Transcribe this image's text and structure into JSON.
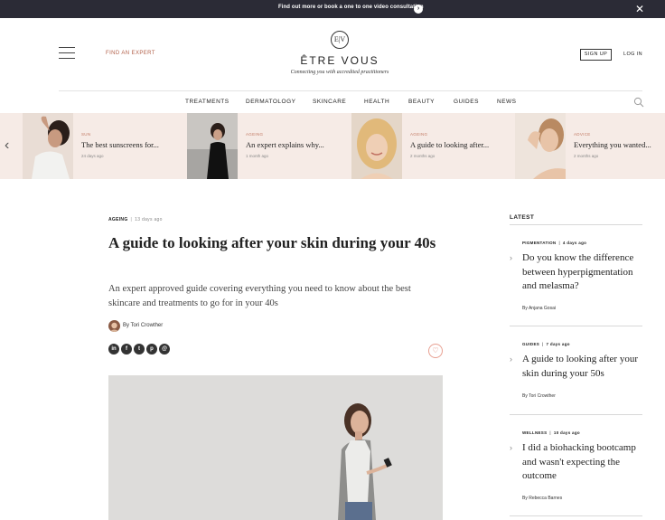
{
  "promo": {
    "text": "Find out more or book a one to one video consultation",
    "arrow_icon": "chevron-right-icon",
    "close_icon": "close-icon"
  },
  "header": {
    "find_expert": "FIND AN EXPERT",
    "logo_mark": "E|V",
    "logo_text": "ÊTRE VOUS",
    "tagline": "Connecting you with accredited practitioners",
    "signup": "SIGN UP",
    "login": "LOG IN"
  },
  "nav": {
    "items": [
      "TREATMENTS",
      "DERMATOLOGY",
      "SKINCARE",
      "HEALTH",
      "BEAUTY",
      "GUIDES",
      "NEWS"
    ],
    "search_icon": "search-icon"
  },
  "carousel": {
    "prev_icon": "chevron-left-icon",
    "cards": [
      {
        "category": "SUN",
        "title": "The best sunscreens for...",
        "meta": "24 days ago"
      },
      {
        "category": "AGEING",
        "title": "An expert explains why...",
        "meta": "1 month ago"
      },
      {
        "category": "AGEING",
        "title": "A guide to looking after...",
        "meta": "2 months ago"
      },
      {
        "category": "ADVICE",
        "title": "Everything you wanted...",
        "meta": "2 months ago"
      }
    ]
  },
  "article": {
    "category": "AGEING",
    "time": "13 days ago",
    "title": "A guide to looking after your skin during your 40s",
    "subtitle": "An expert approved guide covering everything you need to know about the best skincare and treatments to go for in your 40s",
    "author": "By Tori Crowther",
    "share_icons": [
      "linkedin-icon",
      "facebook-icon",
      "twitter-icon",
      "pinterest-icon",
      "email-icon"
    ],
    "share_glyphs": [
      "in",
      "f",
      "t",
      "p",
      "@"
    ],
    "heart_icon": "heart-icon"
  },
  "latest": {
    "heading": "LATEST",
    "items": [
      {
        "category": "PIGMENTATION",
        "time": "4 days ago",
        "title": "Do you know the difference between hyperpigmentation and melasma?",
        "author": "By Anjana Gosai"
      },
      {
        "category": "GUIDES",
        "time": "7 days ago",
        "title": "A guide to looking after your skin during your 50s",
        "author": "By Tori Crowther"
      },
      {
        "category": "WELLNESS",
        "time": "10 days ago",
        "title": "I did a biohacking bootcamp and wasn't expecting the outcome",
        "author": "By Rebecca Barnes"
      }
    ]
  },
  "colors": {
    "accent": "#b2604a",
    "carousel_bg": "#f6ebe6",
    "promo_bg": "#2b2b36"
  }
}
